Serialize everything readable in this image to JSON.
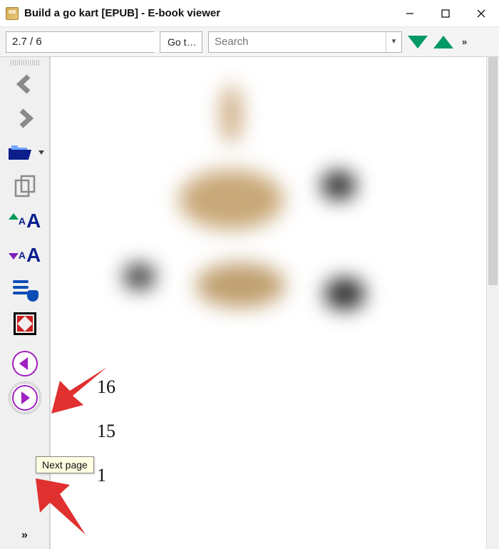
{
  "window": {
    "title": "Build a go kart [EPUB] - E-book viewer"
  },
  "toolbar": {
    "page_position": "2.7 / 6",
    "goto_label": "Go t…",
    "search_placeholder": "Search"
  },
  "sidebar": {
    "back_label": "Back",
    "forward_label": "Forward",
    "open_label": "Open ebook",
    "copy_label": "Copy to clipboard",
    "font_bigger_label": "Increase font size",
    "font_smaller_label": "Decrease font size",
    "toc_label": "Table of Contents",
    "fullscreen_label": "Toggle full screen",
    "prev_page_label": "Previous page",
    "next_page_label": "Next page"
  },
  "content": {
    "numbers": [
      "16",
      "15",
      "1"
    ]
  },
  "tooltip": {
    "text": "Next page"
  }
}
